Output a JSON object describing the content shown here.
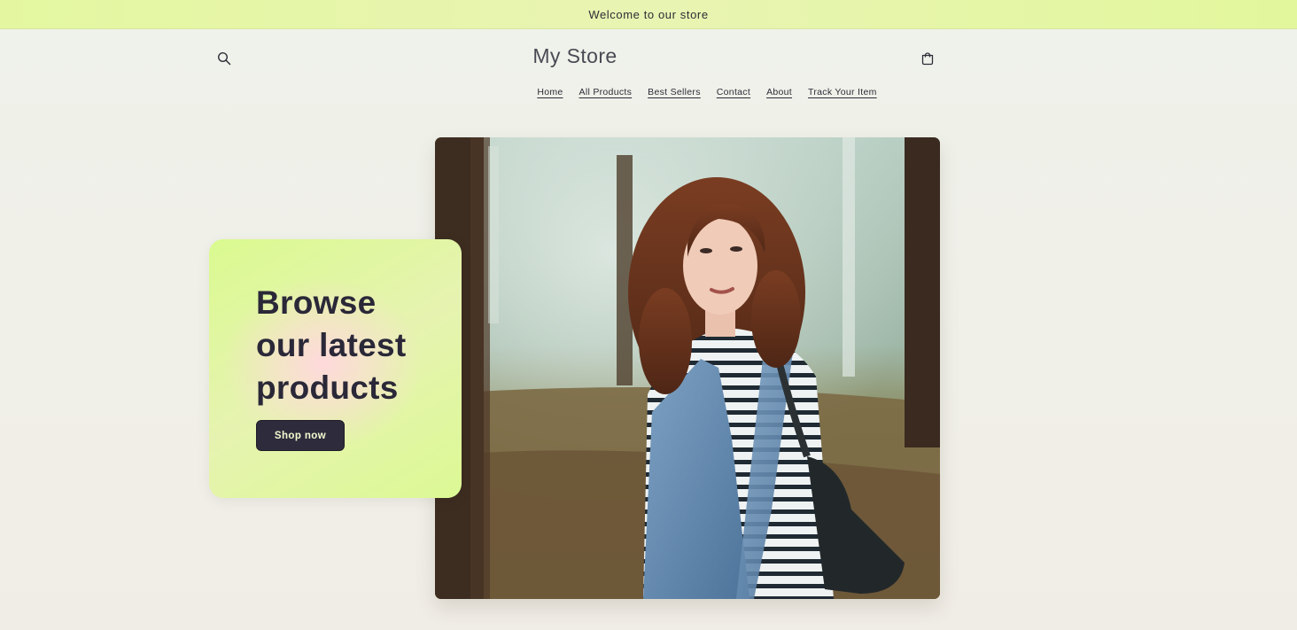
{
  "announcement": {
    "text": "Welcome to our store"
  },
  "header": {
    "logo": "My Store",
    "search_icon": "search-icon",
    "cart_icon": "shopping-bag-icon"
  },
  "nav": {
    "items": [
      {
        "label": "Home"
      },
      {
        "label": "All Products"
      },
      {
        "label": "Best Sellers"
      },
      {
        "label": "Contact"
      },
      {
        "label": "About"
      },
      {
        "label": "Track Your Item"
      }
    ]
  },
  "hero": {
    "title_lines": [
      "Browse",
      "our latest",
      "products"
    ],
    "button_label": "Shop now",
    "image": "woman-in-park-photo"
  },
  "colors": {
    "accent": "#e2f79c",
    "button_bg": "#2e2b3c",
    "button_text": "#f4fbd0",
    "background": "#f0efe8"
  }
}
